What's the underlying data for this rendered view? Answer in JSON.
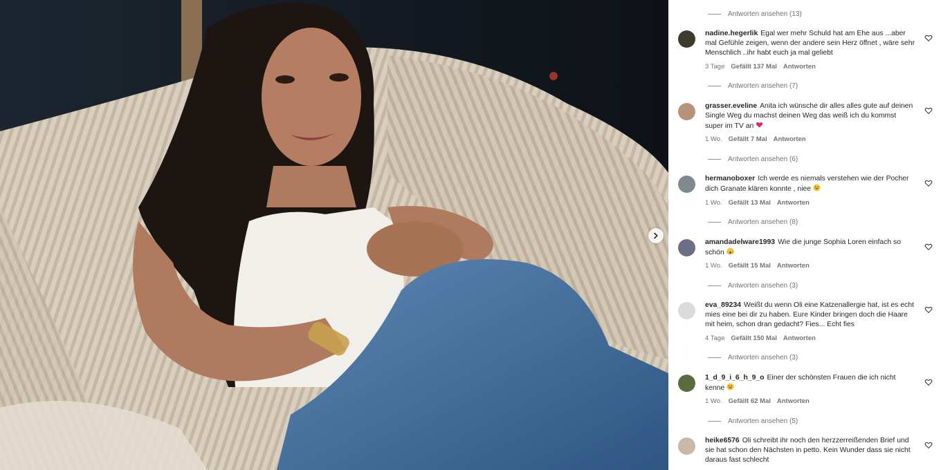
{
  "colors": {
    "accent_heart": "#e0245e",
    "muted": "#737373",
    "text": "#262626"
  },
  "icons": {
    "next": "chevron-right-icon",
    "like": "heart-outline-icon"
  },
  "top_replies": {
    "label": "Antworten ansehen (13)"
  },
  "comments": [
    {
      "username": "nadine.hegerlik",
      "text": "Egal wer mehr Schuld hat am Ehe aus ...aber mal Gefühle zeigen, wenn der andere sein Herz öffnet , wäre sehr Menschlich ..ihr habt euch ja mal geliebt",
      "time": "3 Tage",
      "likes": "Gefällt 137 Mal",
      "reply": "Antworten",
      "view_replies": "Antworten ansehen (7)",
      "avatar_color": "#3d3a2e"
    },
    {
      "username": "grasser.eveline",
      "text": "Anita ich wünsche dir alles alles gute auf deinen Single Weg du machst deinen Weg das weiß ich du kommst super im TV an",
      "emoji": "red-heart",
      "time": "1 Wo.",
      "likes": "Gefällt 7 Mal",
      "reply": "Antworten",
      "view_replies": "Antworten ansehen (6)",
      "avatar_color": "#b8927a"
    },
    {
      "username": "hermanoboxer",
      "text": "Ich werde es niemals verstehen wie der Pocher dich Granate klären konnte , niee",
      "emoji": "grinning-face",
      "time": "1 Wo.",
      "likes": "Gefällt 13 Mal",
      "reply": "Antworten",
      "view_replies": "Antworten ansehen (8)",
      "avatar_color": "#7f8a8f"
    },
    {
      "username": "amandadelware1993",
      "text": "Wie die junge Sophia Loren einfach so schön",
      "emoji": "screaming-face",
      "time": "1 Wo.",
      "likes": "Gefällt 15 Mal",
      "reply": "Antworten",
      "view_replies": "Antworten ansehen (3)",
      "avatar_color": "#6b6f86"
    },
    {
      "username": "eva_89234",
      "text": "Weißt du wenn Oli eine Katzenallergie hat, ist es echt mies eine bei dir zu haben. Eure Kinder bringen doch die Haare mit heim, schon dran gedacht? Fies... Echt fies",
      "time": "4 Tage",
      "likes": "Gefällt 150 Mal",
      "reply": "Antworten",
      "view_replies": "Antworten ansehen (3)",
      "avatar_color": "#dbdbdb"
    },
    {
      "username": "1_d_9_i_6_h_9_o",
      "text": "Einer der schönsten Frauen die ich nicht kenne",
      "emoji": "grinning-face",
      "time": "1 Wo.",
      "likes": "Gefällt 62 Mal",
      "reply": "Antworten",
      "view_replies": "Antworten ansehen (5)",
      "avatar_color": "#5a6b3e"
    },
    {
      "username": "heike6576",
      "text": "Oli schreibt ihr noch den herzzerreißenden Brief und sie hat schon den Nächsten in petto. Kein Wunder dass sie nicht daraus fast schlecht",
      "time": "",
      "likes": "",
      "reply": "",
      "view_replies": "",
      "avatar_color": "#c9b7a8"
    }
  ]
}
